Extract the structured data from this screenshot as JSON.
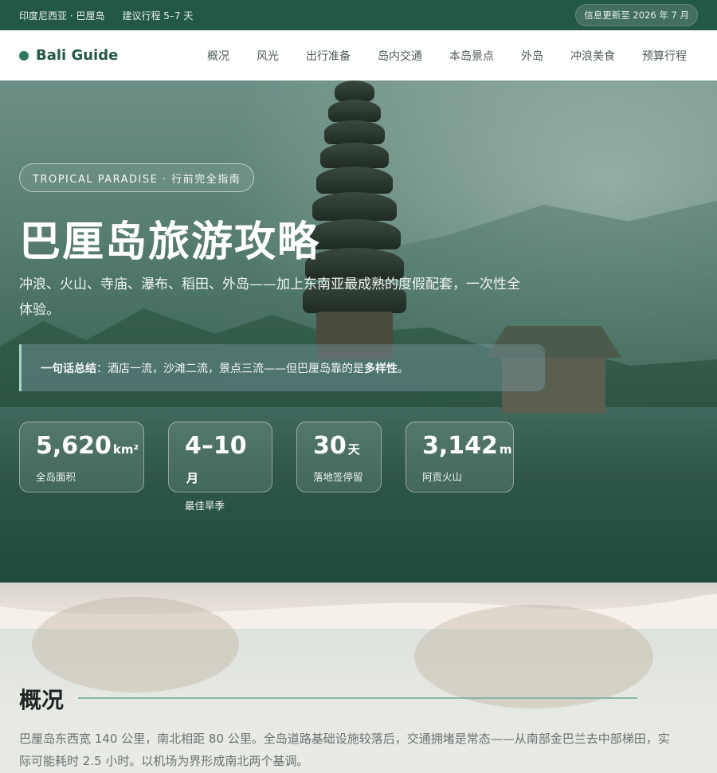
{
  "topbar": {
    "location": "印度尼西亚 · 巴厘岛",
    "duration": "建议行程 5–7 天",
    "updated": "信息更新至 2026 年 7 月"
  },
  "nav": {
    "brand": "Bali Guide",
    "items": [
      "概况",
      "风光",
      "出行准备",
      "岛内交通",
      "本岛景点",
      "外岛",
      "冲浪美食",
      "预算行程"
    ]
  },
  "hero": {
    "pill": "TROPICAL PARADISE · 行前完全指南",
    "title": "巴厘岛旅游攻略",
    "subtitle": "冲浪、火山、寺庙、瀑布、稻田、外岛——加上东南亚最成熟的度假配套，一次性全体验。",
    "quote_label": "一句话总结",
    "quote_text": "：酒店一流，沙滩二流，景点三流——但巴厘岛靠的是",
    "quote_emph": "多样性",
    "quote_end": "。"
  },
  "stats": [
    {
      "value": "5,620",
      "unit": "km²",
      "label": "全岛面积"
    },
    {
      "value": "4–10",
      "unit": "月",
      "label": "最佳旱季"
    },
    {
      "value": "30",
      "unit": "天",
      "label": "落地签停留"
    },
    {
      "value": "3,142",
      "unit": "m",
      "label": "阿贡火山"
    }
  ],
  "overview": {
    "heading": "概况",
    "text": "巴厘岛东西宽 140 公里，南北相距 80 公里。全岛道路基础设施较落后，交通拥堵是常态——从南部金巴兰去中部梯田，实际可能耗时 2.5 小时。以机场为界形成南北两个基调。"
  },
  "colors": {
    "brand_green": "#245846",
    "accent": "#2f7a5c"
  }
}
